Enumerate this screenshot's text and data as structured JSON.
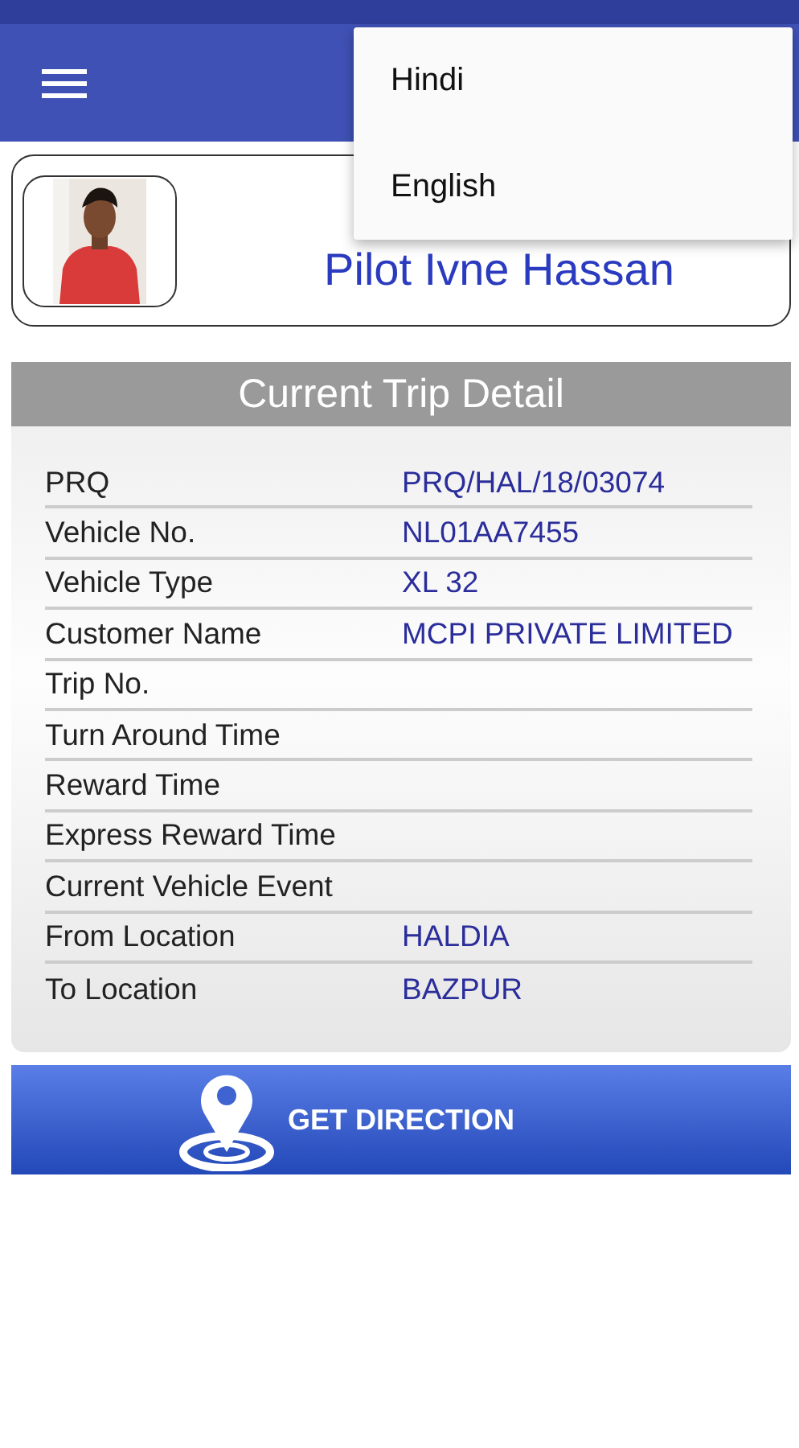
{
  "language_menu": {
    "items": [
      {
        "label": "Hindi"
      },
      {
        "label": "English"
      }
    ]
  },
  "profile": {
    "name": "Pilot Ivne Hassan"
  },
  "trip": {
    "title": "Current Trip Detail",
    "rows": [
      {
        "label": "PRQ",
        "value": "PRQ/HAL/18/03074"
      },
      {
        "label": "Vehicle No.",
        "value": "NL01AA7455"
      },
      {
        "label": "Vehicle Type",
        "value": "XL 32"
      },
      {
        "label": "Customer Name",
        "value": "MCPI PRIVATE LIMITED"
      },
      {
        "label": "Trip No."
      },
      {
        "label": "Turn Around Time"
      },
      {
        "label": "Reward Time"
      },
      {
        "label": "Express Reward Time"
      },
      {
        "label": "Current Vehicle Event"
      },
      {
        "label": "From Location",
        "value": "HALDIA"
      },
      {
        "label": "To Location",
        "value": "BAZPUR"
      }
    ]
  },
  "direction_button": {
    "label": "GET DIRECTION"
  }
}
